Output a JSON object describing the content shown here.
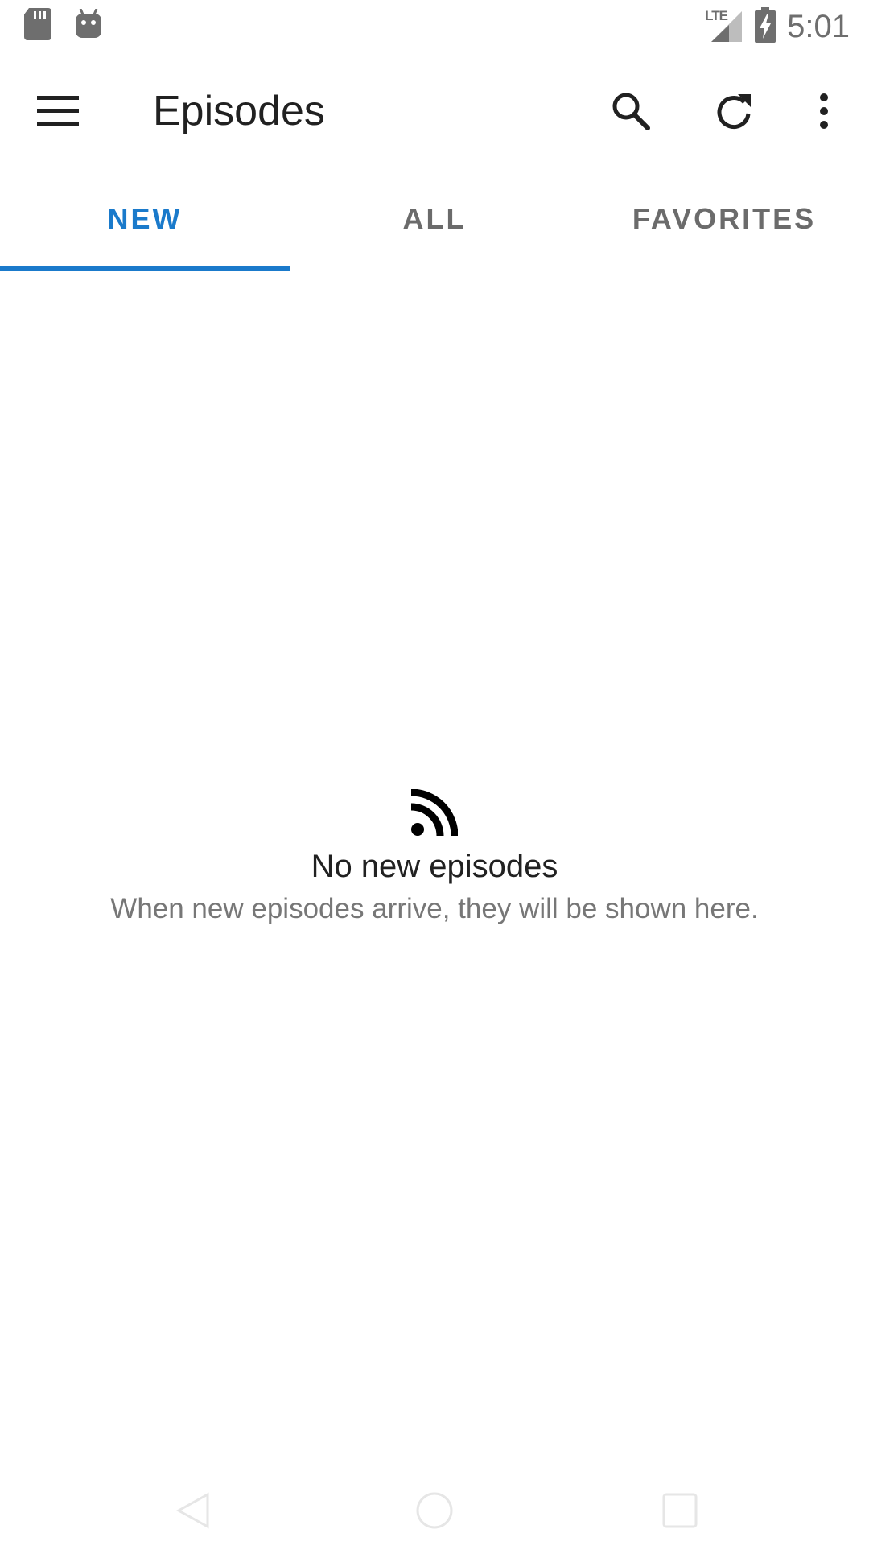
{
  "status_bar": {
    "time": "5:01",
    "network": "LTE",
    "icons": [
      "sd-card-icon",
      "android-debug-icon",
      "signal-icon",
      "battery-charging-icon"
    ]
  },
  "app_bar": {
    "title": "Episodes",
    "actions": [
      "search-icon",
      "refresh-icon",
      "more-vert-icon"
    ]
  },
  "tabs": [
    {
      "label": "NEW",
      "selected": true
    },
    {
      "label": "ALL",
      "selected": false
    },
    {
      "label": "FAVORITES",
      "selected": false
    }
  ],
  "empty_state": {
    "icon": "rss-feed-icon",
    "title": "No new episodes",
    "message": "When new episodes arrive, they will be shown here."
  },
  "nav_bar": {
    "buttons": [
      "back-icon",
      "home-icon",
      "recents-icon"
    ]
  },
  "colors": {
    "accent": "#1a7acb",
    "tab_inactive": "#6b6b6b",
    "icon_gray": "#6e6e6e"
  }
}
